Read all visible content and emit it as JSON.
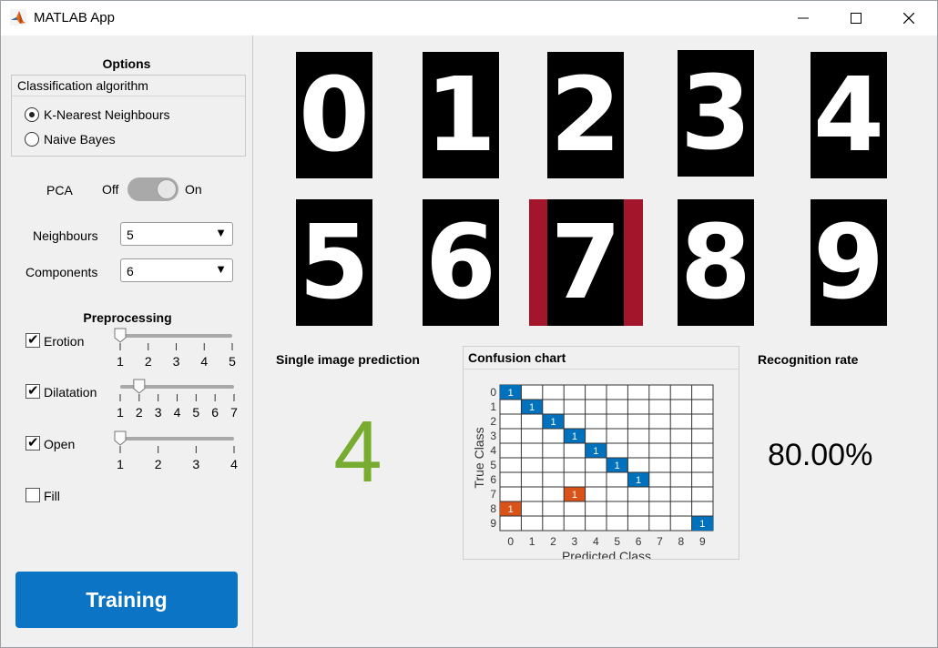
{
  "window": {
    "title": "MATLAB App"
  },
  "options": {
    "title": "Options",
    "group_title": "Classification algorithm",
    "algorithms": [
      {
        "label": "K-Nearest Neighbours",
        "selected": true
      },
      {
        "label": "Naive Bayes",
        "selected": false
      }
    ],
    "pca": {
      "label": "PCA",
      "off": "Off",
      "on": "On",
      "state": "on"
    },
    "neighbours": {
      "label": "Neighbours",
      "value": "5"
    },
    "components": {
      "label": "Components",
      "value": "6"
    }
  },
  "preprocessing": {
    "title": "Preprocessing",
    "items": [
      {
        "label": "Erotion",
        "checked": true,
        "ticks": [
          "1",
          "2",
          "3",
          "4",
          "5"
        ],
        "value": 1
      },
      {
        "label": "Dilatation",
        "checked": true,
        "ticks": [
          "1",
          "2",
          "3",
          "4",
          "5",
          "6",
          "7"
        ],
        "value": 2
      },
      {
        "label": "Open",
        "checked": true,
        "ticks": [
          "1",
          "2",
          "3",
          "4"
        ],
        "value": 1
      },
      {
        "label": "Fill",
        "checked": false
      }
    ]
  },
  "training_button": "Training",
  "digits": [
    "0",
    "1",
    "2",
    "3",
    "4",
    "5",
    "6",
    "7",
    "8",
    "9"
  ],
  "selected_digit": "7",
  "selection_color": "#a3152b",
  "prediction": {
    "title": "Single image prediction",
    "value": "4",
    "color": "#77ac30"
  },
  "recognition": {
    "title": "Recognition rate",
    "value": "80.00%"
  },
  "confusion_chart": {
    "title": "Confusion chart"
  },
  "chart_data": {
    "type": "heatmap",
    "xlabel": "Predicted Class",
    "ylabel": "True Class",
    "categories": [
      "0",
      "1",
      "2",
      "3",
      "4",
      "5",
      "6",
      "7",
      "8",
      "9"
    ],
    "cells": [
      {
        "true": "0",
        "pred": "0",
        "value": 1,
        "kind": "correct"
      },
      {
        "true": "1",
        "pred": "1",
        "value": 1,
        "kind": "correct"
      },
      {
        "true": "2",
        "pred": "2",
        "value": 1,
        "kind": "correct"
      },
      {
        "true": "3",
        "pred": "3",
        "value": 1,
        "kind": "correct"
      },
      {
        "true": "4",
        "pred": "4",
        "value": 1,
        "kind": "correct"
      },
      {
        "true": "5",
        "pred": "5",
        "value": 1,
        "kind": "correct"
      },
      {
        "true": "6",
        "pred": "6",
        "value": 1,
        "kind": "correct"
      },
      {
        "true": "7",
        "pred": "3",
        "value": 1,
        "kind": "incorrect"
      },
      {
        "true": "8",
        "pred": "0",
        "value": 1,
        "kind": "incorrect"
      },
      {
        "true": "9",
        "pred": "9",
        "value": 1,
        "kind": "correct"
      }
    ],
    "colors": {
      "correct": "#0072bd",
      "incorrect": "#d95319"
    }
  }
}
